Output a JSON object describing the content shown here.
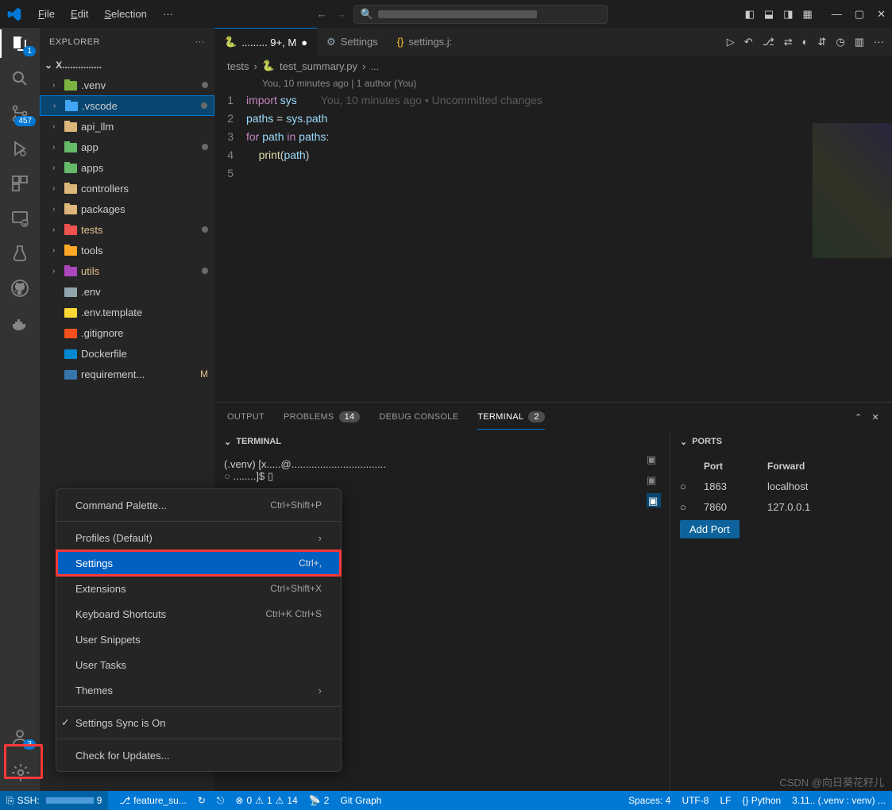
{
  "menu": {
    "file": "File",
    "edit": "Edit",
    "selection": "Selection",
    "more": "···"
  },
  "search": {
    "placeholder": ""
  },
  "activity": {
    "explorer_badge": "1",
    "scm_badge": "457",
    "account_badge": "3"
  },
  "sidebar": {
    "title": "EXPLORER",
    "folder": "X...............",
    "tree": [
      {
        "icon": "folder-venv",
        "label": ".venv",
        "chev": true,
        "status": "dot"
      },
      {
        "icon": "folder-vscode",
        "label": ".vscode",
        "chev": true,
        "selected": true,
        "status": "dot"
      },
      {
        "icon": "folder",
        "label": "api_llm",
        "chev": true
      },
      {
        "icon": "folder-app",
        "label": "app",
        "chev": true,
        "status": "dot"
      },
      {
        "icon": "folder-app",
        "label": "apps",
        "chev": true
      },
      {
        "icon": "folder",
        "label": "controllers",
        "chev": true
      },
      {
        "icon": "folder",
        "label": "packages",
        "chev": true
      },
      {
        "icon": "folder-test",
        "label": "tests",
        "chev": true,
        "modified": true,
        "status": "dot"
      },
      {
        "icon": "folder-tool",
        "label": "tools",
        "chev": true
      },
      {
        "icon": "folder-util",
        "label": "utils",
        "chev": true,
        "modified": true,
        "status": "dot"
      },
      {
        "icon": "gear-file",
        "label": ".env",
        "chev": false
      },
      {
        "icon": "env-file",
        "label": ".env.template",
        "chev": false
      },
      {
        "icon": "git-file",
        "label": ".gitignore",
        "chev": false
      },
      {
        "icon": "docker-file",
        "label": "Dockerfile",
        "chev": false
      },
      {
        "icon": "python-file",
        "label": "requirement...",
        "chev": false,
        "mstatus": "M"
      }
    ]
  },
  "tabs": [
    {
      "icon": "python-file",
      "label": "......... 9+, M",
      "active": true,
      "dirty": true
    },
    {
      "icon": "gear-icon",
      "label": "Settings"
    },
    {
      "icon": "braces-icon",
      "label": "settings.j:"
    }
  ],
  "tab_actions_icons": [
    "play",
    "undo",
    "branch",
    "compare",
    "diff",
    "arrows",
    "clock",
    "layout",
    "more"
  ],
  "breadcrumb": {
    "seg1": "tests",
    "seg2": "test_summary.py",
    "seg3": "..."
  },
  "codelens": "You, 10 minutes ago | 1 author (You)",
  "code": [
    {
      "n": "1",
      "html": "<span class='kw'>import</span> <span class='var'>sys</span><span class='inline-blame'>You, 10 minutes ago • Uncommitted changes</span>"
    },
    {
      "n": "2",
      "html": "<span class='var'>paths</span> = <span class='var'>sys</span>.<span class='var'>path</span>"
    },
    {
      "n": "3",
      "html": "<span class='kw'>for</span> <span class='var'>path</span> <span class='kw'>in</span> <span class='var'>paths</span>:"
    },
    {
      "n": "4",
      "html": "    <span class='fn'>print</span>(<span class='var'>path</span>)"
    },
    {
      "n": "5",
      "html": ""
    }
  ],
  "panel": {
    "tabs": {
      "output": "OUTPUT",
      "problems": "PROBLEMS",
      "problems_badge": "14",
      "debug": "DEBUG CONSOLE",
      "terminal": "TERMINAL",
      "terminal_badge": "2"
    },
    "terminal_header": "TERMINAL",
    "terminal_lines": [
      "(.venv) [x.....@.................................",
      "........]$ ▯"
    ],
    "ports_header": "PORTS",
    "ports_cols": {
      "port": "Port",
      "fwd": "Forward"
    },
    "ports": [
      {
        "port": "1863",
        "fwd": "localhost"
      },
      {
        "port": "7860",
        "fwd": "127.0.0.1"
      }
    ],
    "add_port": "Add Port"
  },
  "context_menu": [
    {
      "label": "Command Palette...",
      "kbd": "Ctrl+Shift+P"
    },
    {
      "sep": true
    },
    {
      "label": "Profiles (Default)",
      "sub": true
    },
    {
      "label": "Settings",
      "kbd": "Ctrl+,",
      "hl": true
    },
    {
      "label": "Extensions",
      "kbd": "Ctrl+Shift+X"
    },
    {
      "label": "Keyboard Shortcuts",
      "kbd": "Ctrl+K Ctrl+S"
    },
    {
      "label": "User Snippets"
    },
    {
      "label": "User Tasks"
    },
    {
      "label": "Themes",
      "sub": true
    },
    {
      "sep": true
    },
    {
      "label": "Settings Sync is On",
      "check": true
    },
    {
      "sep": true
    },
    {
      "label": "Check for Updates..."
    }
  ],
  "statusbar": {
    "remote": "SSH:",
    "branch_num": "9",
    "branch": "feature_su...",
    "sync": "↻",
    "errors": "0",
    "warnings": "1",
    "ports_warn": "14",
    "radio": "2",
    "gitgraph": "Git Graph",
    "spaces": "Spaces: 4",
    "encoding": "UTF-8",
    "eol": "LF",
    "lang": "{} Python",
    "interp": "3.11.. (.venv : venv) ..."
  },
  "watermark": "CSDN @向日葵花籽儿"
}
